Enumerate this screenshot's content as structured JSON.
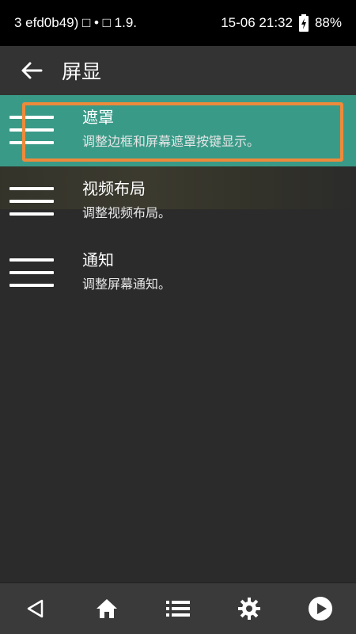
{
  "status_bar": {
    "left_text": "3  efd0b49) □ • □ 1.9.",
    "time": "15-06 21:32",
    "battery": "88%",
    "icons": [
      "square-icon",
      "dot-icon",
      "battery-charging-icon"
    ]
  },
  "app_bar": {
    "title": "屏显",
    "back_icon": "arrow-left-icon"
  },
  "list": {
    "items": [
      {
        "title": "遮罩",
        "subtitle": "调整边框和屏幕遮罩按键显示。",
        "icon": "menu-icon",
        "selected": true
      },
      {
        "title": "视频布局",
        "subtitle": "调整视频布局。",
        "icon": "menu-icon",
        "selected": false
      },
      {
        "title": "通知",
        "subtitle": "调整屏幕通知。",
        "icon": "menu-icon",
        "selected": false
      }
    ]
  },
  "bottom_nav": {
    "items": [
      "back-triangle-icon",
      "home-icon",
      "list-icon",
      "gear-icon",
      "play-circle-icon"
    ]
  },
  "colors": {
    "selected_bg": "#3a9a88",
    "highlight_border": "#ee8a3a",
    "background": "#2b2b2b",
    "app_bar": "#333333"
  }
}
